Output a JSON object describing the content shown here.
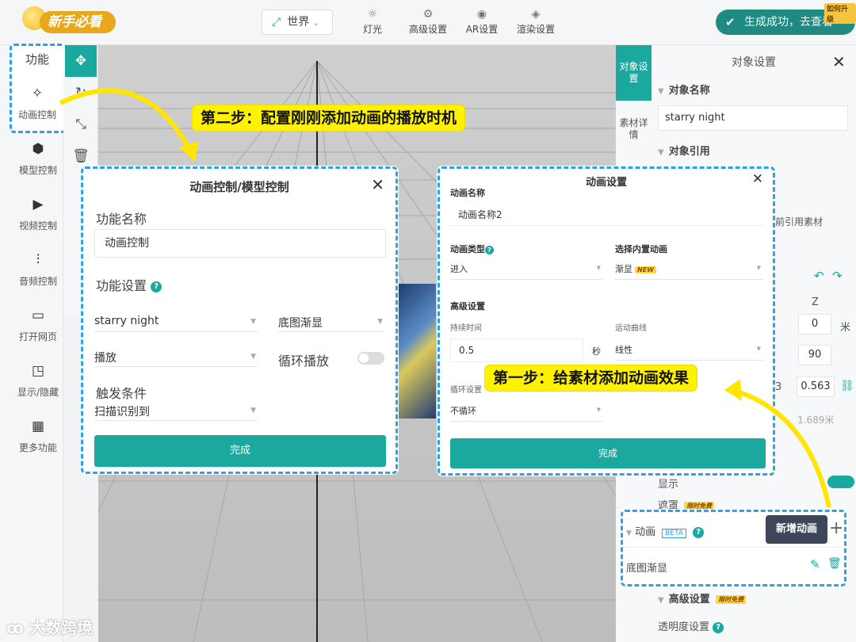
{
  "topbar": {
    "logo_text": "新手必看",
    "world_label": "世界",
    "nav": [
      {
        "label": "灯光",
        "icon": "sun-icon"
      },
      {
        "label": "高级设置",
        "icon": "gear-icon"
      },
      {
        "label": "AR设置",
        "icon": "ar-icon"
      },
      {
        "label": "渲染设置",
        "icon": "paint-bucket-icon"
      }
    ],
    "success_text": "生成成功，去查看",
    "vip_badge": "如何升级"
  },
  "sidebar": {
    "header": "功能",
    "items": [
      {
        "label": "动画控制",
        "icon": "sparkle-icon"
      },
      {
        "label": "模型控制",
        "icon": "cube-icon"
      },
      {
        "label": "视频控制",
        "icon": "play-icon"
      },
      {
        "label": "音频控制",
        "icon": "sliders-icon"
      },
      {
        "label": "打开网页",
        "icon": "monitor-icon"
      },
      {
        "label": "显示/隐藏",
        "icon": "eye-toggle-icon"
      },
      {
        "label": "更多功能",
        "icon": "grid-icon"
      }
    ]
  },
  "right_panel": {
    "tab_object": "对象设置",
    "tab_material": "素材详情",
    "title": "对象设置",
    "section_name": "对象名称",
    "object_name": "starry night",
    "section_ref": "对象引用",
    "ref_text": "前引用素材",
    "axis_z": "Z",
    "z_value": "0",
    "unit_m": "米",
    "rot_value": "90",
    "scale_left": "3",
    "scale_value": "0.563",
    "size_text": "1.689米",
    "display_label": "显示",
    "mask_label": "遮罩",
    "mask_badge": "限时免费",
    "advanced_label": "高级设置",
    "advanced_badge": "限时免费",
    "opacity_label": "透明度设置"
  },
  "dialog_left": {
    "title": "动画控制/模型控制",
    "name_label": "功能名称",
    "name_value": "动画控制",
    "settings_label": "功能设置",
    "target_select": "starry night",
    "anim_select": "底图渐显",
    "action_select": "播放",
    "loop_label": "循环播放",
    "trigger_label": "触发条件",
    "trigger_select": "扫描识别到",
    "done": "完成"
  },
  "dialog_right": {
    "title": "动画设置",
    "name_label": "动画名称",
    "name_value": "动画名称2",
    "type_label": "动画类型",
    "type_value": "进入",
    "builtin_label": "选择内置动画",
    "builtin_value": "渐显",
    "new_tag": "NEW",
    "advanced_label": "高级设置",
    "duration_label": "持续时间",
    "duration_value": "0.5",
    "duration_unit": "秒",
    "curve_label": "运动曲线",
    "curve_value": "线性",
    "loop_label": "循环设置",
    "loop_value": "不循环",
    "done": "完成"
  },
  "anim_panel": {
    "title": "动画",
    "beta": "BETA",
    "add_tooltip": "新增动画",
    "item": "底图渐显"
  },
  "callouts": {
    "step2": "第二步：配置刚刚添加动画的播放时机",
    "step1": "第一步：给素材添加动画效果"
  },
  "watermark": "大数跨境",
  "colors": {
    "accent": "#1aa89f",
    "highlight": "#fff200",
    "dash": "#2ba3e5"
  }
}
